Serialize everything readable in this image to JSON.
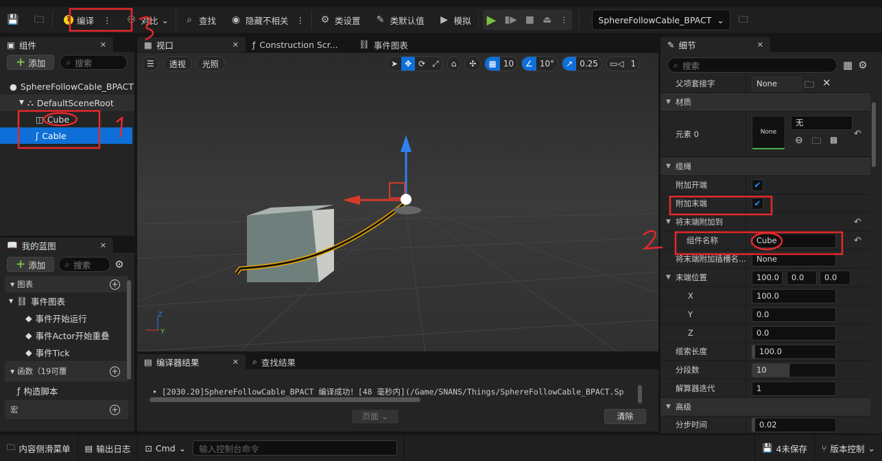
{
  "toolbar": {
    "compile": "编译",
    "diff": "对比",
    "find": "查找",
    "hide_unrelated": "隐藏不相关",
    "class_settings": "类设置",
    "class_defaults": "类默认值",
    "simulate": "模拟",
    "asset": "SphereFollowCable_BPACT",
    "play_color": "#7bc142"
  },
  "components": {
    "tab": "组件",
    "add": "添加",
    "search_placeholder": "搜索",
    "tree": [
      {
        "label": "SphereFollowCable_BPACT"
      },
      {
        "label": "DefaultSceneRoot"
      },
      {
        "label": "Cube"
      },
      {
        "label": "Cable",
        "selected": true
      }
    ]
  },
  "my_blueprint": {
    "tab": "我的蓝图",
    "add": "添加",
    "search_placeholder": "搜索",
    "graphs": "图表",
    "event_graph": "事件图表",
    "events": [
      "事件开始运行",
      "事件Actor开始重叠",
      "事件Tick"
    ],
    "functions": "函数（19可覆",
    "construction": "构造脚本",
    "macros": "宏"
  },
  "viewport": {
    "tabs": [
      "视口",
      "Construction Scr...",
      "事件图表"
    ],
    "perspective": "透视",
    "lit": "光照",
    "grid_snap": "10",
    "rot_snap": "10°",
    "scale_snap": "0.25",
    "camera_speed": "1",
    "accent": "#0e6fd8"
  },
  "compiler": {
    "tabs": [
      "编译器结果",
      "查找结果"
    ],
    "message": "[2030.20]SphereFollowCable_BPACT 编译成功！[48 毫秒内](/Game/SNANS/Things/SphereFollowCable_BPACT.Sp",
    "page": "页面",
    "clear": "清除"
  },
  "details": {
    "tab": "细节",
    "search_placeholder": "搜索",
    "parent_socket_label": "父项套接字",
    "parent_socket": "None",
    "material_cat": "材质",
    "element0": "元素 0",
    "material_thumb": "None",
    "material_value": "无",
    "cable_cat": "缆绳",
    "attach_start": "附加开端",
    "attach_end": "附加末端",
    "attach_end_to": "将末端附加到",
    "component_name_label": "组件名称",
    "component_name": "Cube",
    "socket_label": "将末端附加插槽名...",
    "socket": "None",
    "end_location": "末端位置",
    "end_x": "100.0",
    "end_y": "0.0",
    "end_z": "0.0",
    "x": "X",
    "y": "Y",
    "z": "Z",
    "cable_length_label": "缆索长度",
    "cable_length": "100.0",
    "segments_label": "分段数",
    "segments": "10",
    "solver_label": "解算器迭代",
    "solver": "1",
    "advanced_cat": "高级",
    "substep_label": "分步时间",
    "substep": "0.02"
  },
  "status": {
    "content_drawer": "内容侧滑菜单",
    "output_log": "输出日志",
    "cmd": "Cmd",
    "console_placeholder": "输入控制台命令",
    "unsaved": "4未保存",
    "source_control": "版本控制"
  }
}
